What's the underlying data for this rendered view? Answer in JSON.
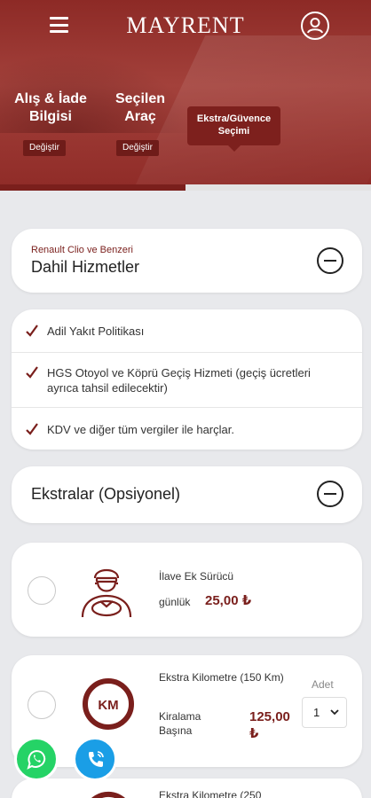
{
  "header": {
    "logo": "MAYRENT",
    "steps": [
      {
        "label": "Alış & İade Bilgisi",
        "change_label": "Değiştir"
      },
      {
        "label": "Seçilen Araç",
        "change_label": "Değiştir"
      },
      {
        "label": "Ekstra/Güvence Seçimi"
      }
    ],
    "progress": 0.5
  },
  "included": {
    "car": "Renault Clio ve Benzeri",
    "title": "Dahil Hizmetler",
    "features": [
      "Adil Yakıt Politikası",
      "HGS Otoyol ve Köprü Geçiş Hizmeti (geçiş ücretleri ayrıca tahsil edilecektir)",
      "KDV ve diğer tüm vergiler ile harçlar."
    ]
  },
  "extras": {
    "title": "Ekstralar (Opsiyonel)",
    "items": [
      {
        "title": "İlave Ek Sürücü",
        "price_label": "günlük",
        "price": "25,00 ₺",
        "icon": "driver-icon"
      },
      {
        "title": "Ekstra Kilometre (150 Km)",
        "price_label": "Kiralama Başına",
        "price": "125,00 ₺",
        "qty_label": "Adet",
        "qty": "1",
        "icon": "km-icon",
        "km_text": "KM"
      },
      {
        "title": "Ekstra Kilometre (250",
        "icon": "km-icon"
      }
    ]
  },
  "colors": {
    "brand": "#7a1f1c",
    "whatsapp": "#25d366",
    "call": "#1a9ee6"
  }
}
